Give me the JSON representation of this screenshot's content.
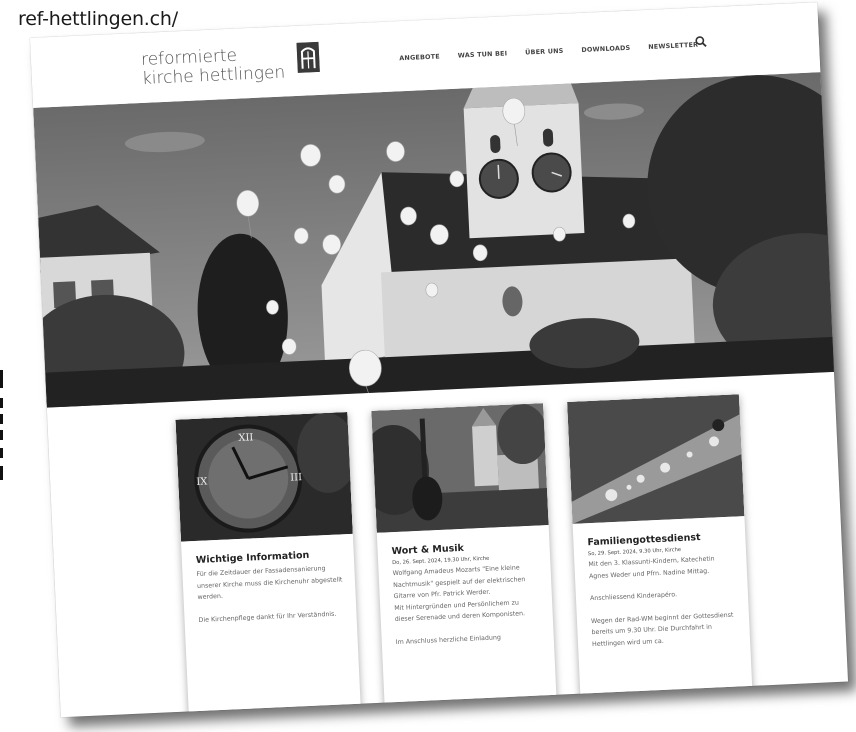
{
  "address": {
    "url": "ref-hettlingen.ch/"
  },
  "header": {
    "logo_line1": "reformierte",
    "logo_line2": "kirche hettlingen",
    "logo_letter": "A",
    "nav": [
      "ANGEBOTE",
      "WAS TUN BEI",
      "ÜBER UNS",
      "DOWNLOADS",
      "NEWSLETTER"
    ],
    "search_icon": "search-icon"
  },
  "cards": [
    {
      "title": "Wichtige Information",
      "date": "",
      "paragraphs": [
        "Für die Zeitdauer der Fassadensanierung unserer Kirche muss die Kirchenuhr abgestellt werden.",
        "Die Kirchenpflege dankt für Ihr Verständnis."
      ]
    },
    {
      "title": "Wort & Musik",
      "date": "Do, 26. Sept. 2024, 19.30 Uhr, Kirche",
      "paragraphs": [
        "Wolfgang Amadeus Mozarts \"Eine kleine Nachtmusik\" gespielt auf der elektrischen Gitarre von Pfr. Patrick Werder.",
        "Mit Hintergründen und Persönlichem zu dieser Serenade und deren Komponisten.",
        "Im Anschluss herzliche Einladung"
      ]
    },
    {
      "title": "Familiengottesdienst",
      "date": "So, 29. Sept. 2024, 9.30 Uhr, Kirche",
      "paragraphs": [
        "Mit den 3. Klassunti-Kindern, Katechetin Agnes Weder und Pfrn. Nadine Mittag.",
        "Anschliessend Kinderapéro.",
        "Wegen der Rad-WM beginnt der Gottesdienst bereits um 9.30 Uhr. Die Durchfahrt in Hettlingen wird um ca."
      ]
    }
  ]
}
